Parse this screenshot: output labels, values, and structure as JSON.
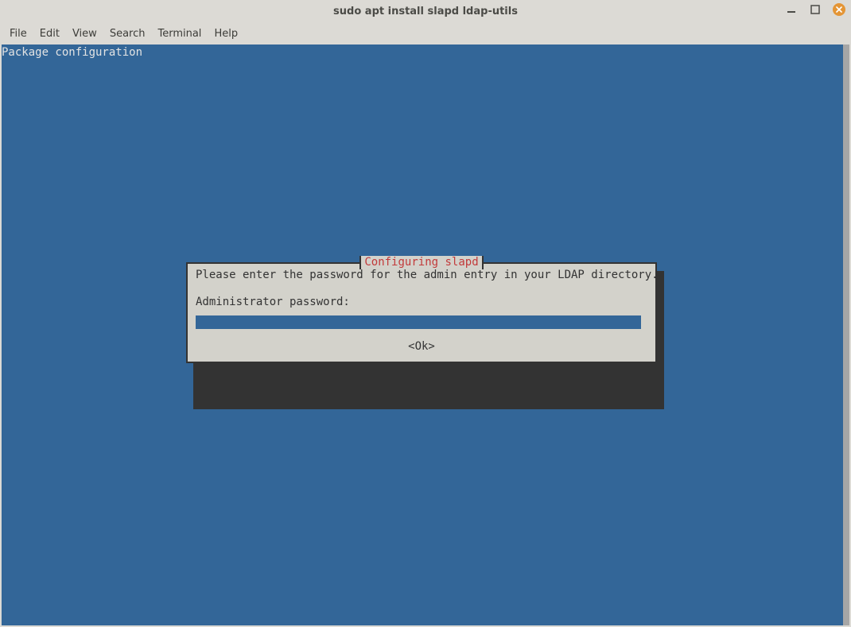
{
  "window": {
    "title": "sudo apt install slapd ldap-utils"
  },
  "menubar": {
    "items": [
      "File",
      "Edit",
      "View",
      "Search",
      "Terminal",
      "Help"
    ]
  },
  "terminal": {
    "header_line": "Package configuration"
  },
  "dialog": {
    "title": " Configuring slapd ",
    "message": "Please enter the password for the admin entry in your LDAP directory.",
    "prompt_label": "Administrator password:",
    "password_value": "",
    "ok_label": "<Ok>"
  }
}
